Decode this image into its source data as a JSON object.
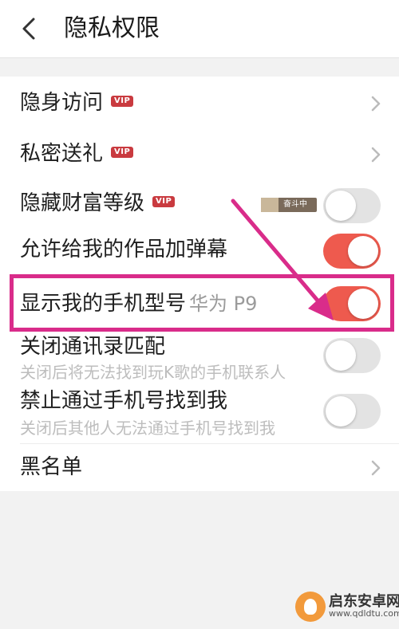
{
  "header": {
    "title": "隐私权限"
  },
  "rows": [
    {
      "label": "隐身访问",
      "vip": "VIP",
      "control": "chevron"
    },
    {
      "label": "私密送礼",
      "vip": "VIP",
      "control": "chevron"
    },
    {
      "label": "隐藏财富等级",
      "vip": "VIP",
      "badge": "奋斗中",
      "control": "toggle",
      "on": false
    },
    {
      "label": "允许给我的作品加弹幕",
      "control": "toggle",
      "on": true
    },
    {
      "label": "显示我的手机型号",
      "value": "华为 P9",
      "control": "toggle",
      "on": true
    },
    {
      "label": "关闭通讯录匹配",
      "sublabel": "关闭后将无法找到玩K歌的手机联系人",
      "control": "toggle",
      "on": false
    },
    {
      "label": "禁止通过手机号找到我",
      "sublabel": "关闭后其他人无法通过手机号找到我",
      "control": "toggle",
      "on": false
    },
    {
      "label": "黑名单",
      "control": "chevron"
    }
  ],
  "watermark": {
    "title": "启东安卓网",
    "url": "www.qdldtu.com"
  },
  "colors": {
    "toggle_on": "#ee5a4e",
    "toggle_off": "#e3e3e3",
    "vip": "#c93a3f",
    "highlight": "#d92c8a"
  }
}
